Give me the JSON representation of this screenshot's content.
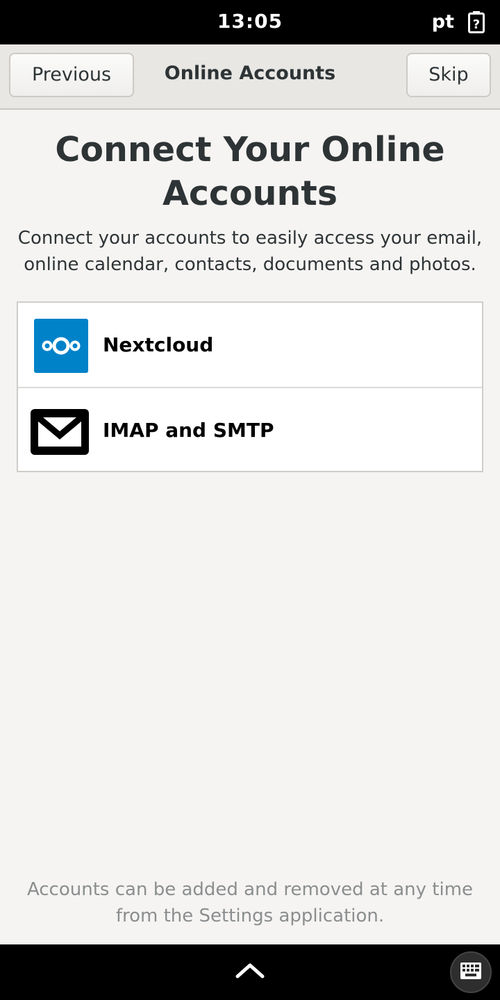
{
  "status_bar": {
    "time": "13:05",
    "keyboard_layout": "pt",
    "battery_icon": "battery-unknown-icon"
  },
  "header": {
    "previous_label": "Previous",
    "title": "Online Accounts",
    "skip_label": "Skip"
  },
  "main": {
    "title": "Connect Your Online Accounts",
    "subtitle": "Connect your accounts to easily access your email, online calendar, contacts, documents and photos.",
    "accounts": [
      {
        "label": "Nextcloud",
        "icon": "nextcloud-icon",
        "icon_color": "#0082c9"
      },
      {
        "label": "IMAP and SMTP",
        "icon": "mail-envelope-icon",
        "icon_color": "#000000"
      }
    ],
    "footer_note": "Accounts can be added and removed at any time from the Settings application."
  },
  "nav_bar": {
    "expand_icon": "chevron-up-icon",
    "keyboard_icon": "keyboard-icon"
  }
}
